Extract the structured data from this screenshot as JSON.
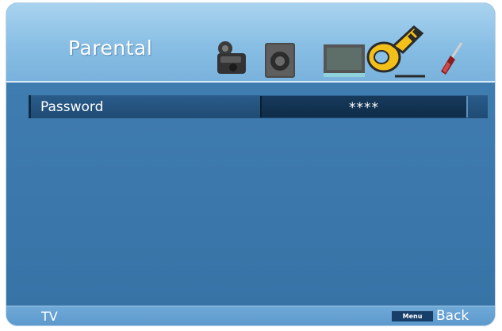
{
  "header": {
    "title": "Parental",
    "icons": [
      {
        "name": "camera-icon",
        "active": false
      },
      {
        "name": "speaker-icon",
        "active": false
      },
      {
        "name": "monitor-icon",
        "active": false
      },
      {
        "name": "key-icon",
        "active": true
      },
      {
        "name": "screwdriver-icon",
        "active": false
      }
    ]
  },
  "menu": {
    "items": [
      {
        "label": "Password",
        "value": "****"
      }
    ]
  },
  "footer": {
    "source": "TV",
    "key_label": "Menu",
    "key_action": "Back"
  },
  "colors": {
    "header": "#88bee4",
    "body": "#3b77aa",
    "row": "#2a5c8a",
    "value_box": "#173a5c",
    "key_gold": "#f3c01a"
  }
}
